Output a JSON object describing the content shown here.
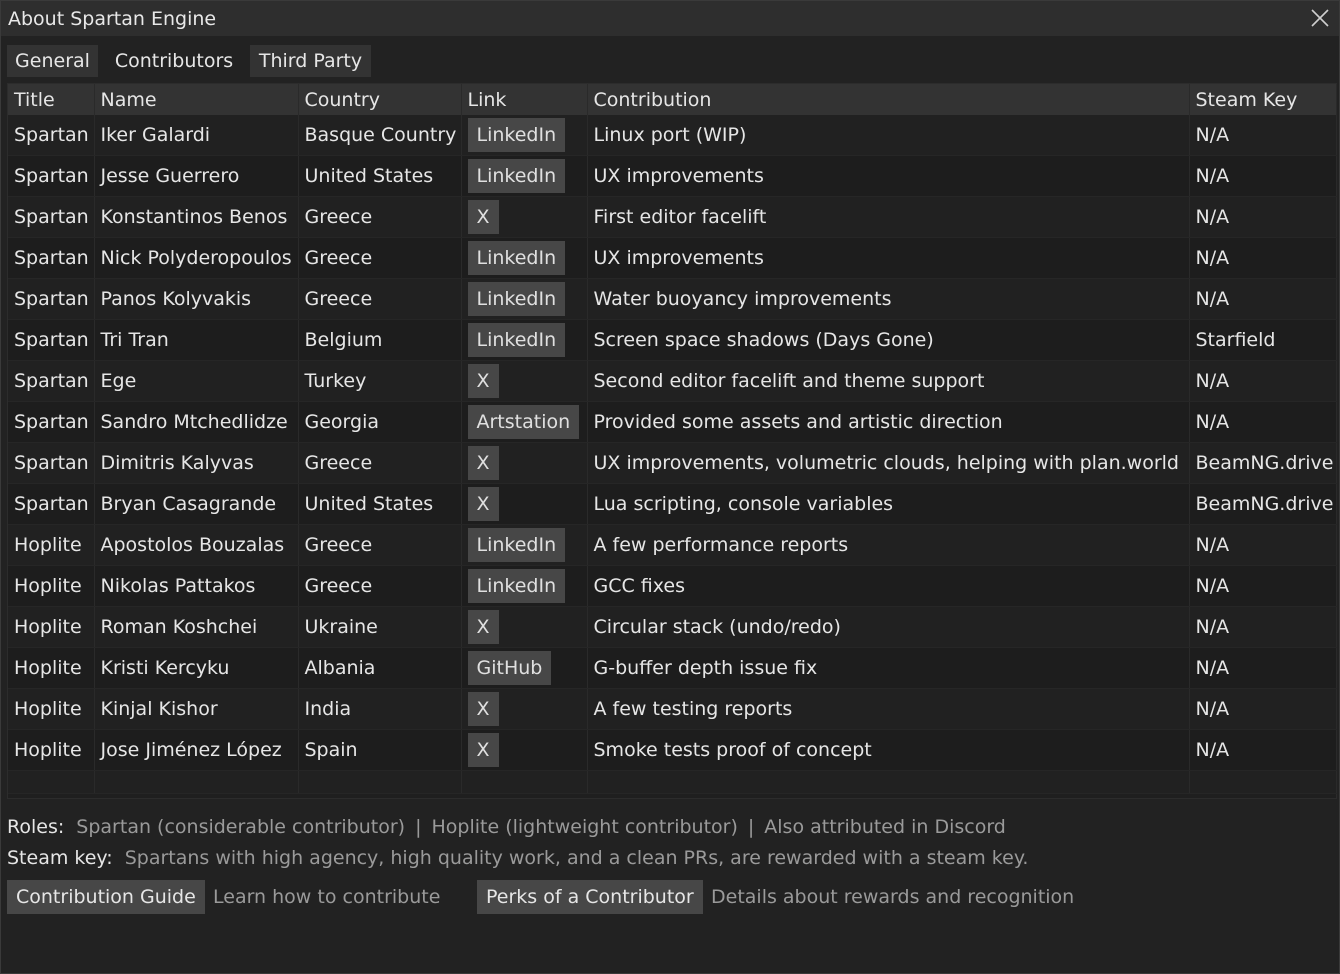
{
  "window": {
    "title": "About Spartan Engine"
  },
  "tabs": [
    {
      "label": "General"
    },
    {
      "label": "Contributors"
    },
    {
      "label": "Third Party"
    }
  ],
  "table": {
    "columns": [
      "Title",
      "Name",
      "Country",
      "Link",
      "Contribution",
      "Steam Key"
    ],
    "rows": [
      {
        "title": "Spartan",
        "name": "Iker Galardi",
        "country": "Basque Country",
        "link": "LinkedIn",
        "contribution": "Linux port (WIP)",
        "steam_key": "N/A"
      },
      {
        "title": "Spartan",
        "name": "Jesse Guerrero",
        "country": "United States",
        "link": "LinkedIn",
        "contribution": "UX improvements",
        "steam_key": "N/A"
      },
      {
        "title": "Spartan",
        "name": "Konstantinos Benos",
        "country": "Greece",
        "link": "X",
        "contribution": "First editor facelift",
        "steam_key": "N/A"
      },
      {
        "title": "Spartan",
        "name": "Nick Polyderopoulos",
        "country": "Greece",
        "link": "LinkedIn",
        "contribution": "UX improvements",
        "steam_key": "N/A"
      },
      {
        "title": "Spartan",
        "name": "Panos Kolyvakis",
        "country": "Greece",
        "link": "LinkedIn",
        "contribution": "Water buoyancy improvements",
        "steam_key": "N/A"
      },
      {
        "title": "Spartan",
        "name": "Tri Tran",
        "country": "Belgium",
        "link": "LinkedIn",
        "contribution": "Screen space shadows (Days Gone)",
        "steam_key": "Starfield"
      },
      {
        "title": "Spartan",
        "name": "Ege",
        "country": "Turkey",
        "link": "X",
        "contribution": "Second editor facelift and theme support",
        "steam_key": "N/A"
      },
      {
        "title": "Spartan",
        "name": "Sandro Mtchedlidze",
        "country": "Georgia",
        "link": "Artstation",
        "contribution": "Provided some assets and artistic direction",
        "steam_key": "N/A"
      },
      {
        "title": "Spartan",
        "name": "Dimitris Kalyvas",
        "country": "Greece",
        "link": "X",
        "contribution": "UX improvements, volumetric clouds, helping with plan.world",
        "steam_key": "BeamNG.drive"
      },
      {
        "title": "Spartan",
        "name": "Bryan Casagrande",
        "country": "United States",
        "link": "X",
        "contribution": "Lua scripting, console variables",
        "steam_key": "BeamNG.drive"
      },
      {
        "title": "Hoplite",
        "name": "Apostolos Bouzalas",
        "country": "Greece",
        "link": "LinkedIn",
        "contribution": "A few performance reports",
        "steam_key": "N/A"
      },
      {
        "title": "Hoplite",
        "name": "Nikolas Pattakos",
        "country": "Greece",
        "link": "LinkedIn",
        "contribution": "GCC fixes",
        "steam_key": "N/A"
      },
      {
        "title": "Hoplite",
        "name": "Roman Koshchei",
        "country": "Ukraine",
        "link": "X",
        "contribution": "Circular stack (undo/redo)",
        "steam_key": "N/A"
      },
      {
        "title": "Hoplite",
        "name": "Kristi Kercyku",
        "country": "Albania",
        "link": "GitHub",
        "contribution": "G-buffer depth issue fix",
        "steam_key": "N/A"
      },
      {
        "title": "Hoplite",
        "name": "Kinjal Kishor",
        "country": "India",
        "link": "X",
        "contribution": "A few testing reports",
        "steam_key": "N/A"
      },
      {
        "title": "Hoplite",
        "name": "Jose Jiménez López",
        "country": "Spain",
        "link": "X",
        "contribution": "Smoke tests proof of concept",
        "steam_key": "N/A"
      }
    ]
  },
  "footer": {
    "roles_label": "Roles:",
    "role_spartan": "Spartan (considerable contributor)",
    "separator": "|",
    "role_hoplite": "Hoplite (lightweight contributor)",
    "role_discord": "Also attributed in Discord",
    "steam_label": "Steam key:",
    "steam_text": "Spartans with high agency, high quality work, and a clean PRs, are rewarded with a steam key.",
    "guide_button": "Contribution Guide",
    "guide_desc": "Learn how to contribute",
    "perks_button": "Perks of a Contributor",
    "perks_desc": "Details about rewards and recognition"
  },
  "icons": {
    "close": "close-icon"
  },
  "colors": {
    "background": "#222222",
    "header": "#333333",
    "button": "#474747",
    "muted_text": "#9a9a9a"
  }
}
